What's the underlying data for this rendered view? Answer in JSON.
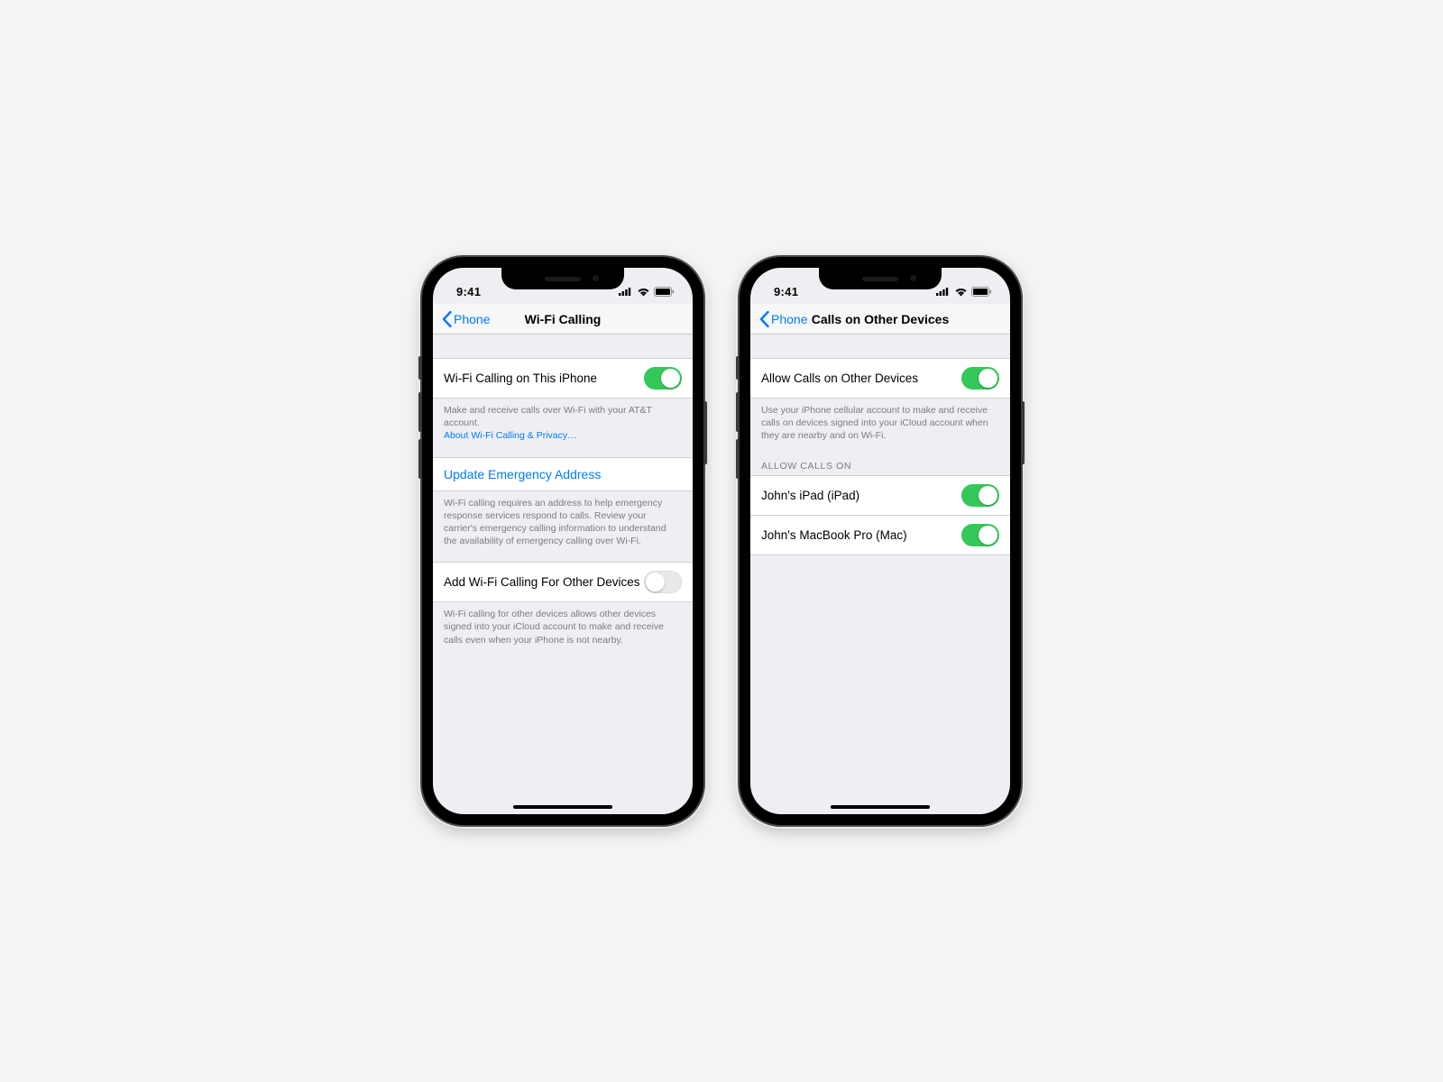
{
  "status": {
    "time": "9:41"
  },
  "left": {
    "nav": {
      "back": "Phone",
      "title": "Wi-Fi Calling"
    },
    "cell1": {
      "label": "Wi-Fi Calling on This iPhone",
      "on": true
    },
    "foot1": {
      "text": "Make and receive calls over Wi-Fi with your AT&T account.",
      "link": "About Wi-Fi Calling & Privacy…"
    },
    "cell2": {
      "label": "Update Emergency Address"
    },
    "foot2": "Wi-Fi calling requires an address to help emergency response services respond to calls. Review your carrier's emergency calling information to understand the availability of emergency calling over Wi-Fi.",
    "cell3": {
      "label": "Add Wi-Fi Calling For Other Devices",
      "on": false
    },
    "foot3": "Wi-Fi calling for other devices allows other devices signed into your iCloud account to make and receive calls even when your iPhone is not nearby."
  },
  "right": {
    "nav": {
      "back": "Phone",
      "title": "Calls on Other Devices"
    },
    "cell1": {
      "label": "Allow Calls on Other Devices",
      "on": true
    },
    "foot1": "Use your iPhone cellular account to make and receive calls on devices signed into your iCloud account when they are nearby and on Wi-Fi.",
    "header": "Allow Calls On",
    "devices": [
      {
        "label": "John's iPad (iPad)",
        "on": true
      },
      {
        "label": "John's MacBook Pro (Mac)",
        "on": true
      }
    ]
  }
}
